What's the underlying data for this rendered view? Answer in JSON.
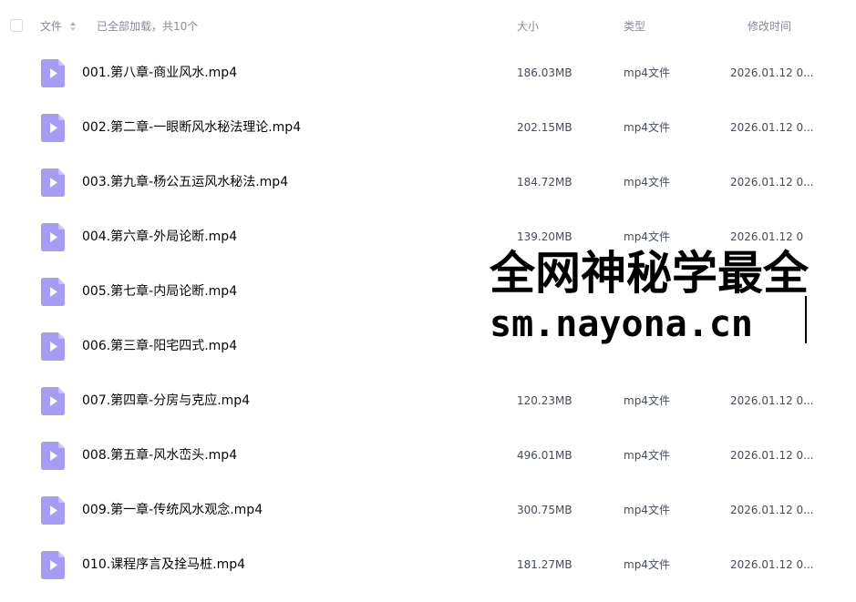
{
  "header": {
    "col_name": "文件",
    "load_status": "已全部加载，共10个",
    "col_size": "大小",
    "col_type": "类型",
    "col_time": "修改时间"
  },
  "files": [
    {
      "name": "001.第八章-商业风水.mp4",
      "size": "186.03MB",
      "type": "mp4文件",
      "time": "2026.01.12 0..."
    },
    {
      "name": "002.第二章-一眼断风水秘法理论.mp4",
      "size": "202.15MB",
      "type": "mp4文件",
      "time": "2026.01.12 0..."
    },
    {
      "name": "003.第九章-杨公五运风水秘法.mp4",
      "size": "184.72MB",
      "type": "mp4文件",
      "time": "2026.01.12 0..."
    },
    {
      "name": "004.第六章-外局论断.mp4",
      "size": "139.20MB",
      "type": "mp4文件",
      "time": "2026.01.12 0"
    },
    {
      "name": "005.第七章-内局论断.mp4",
      "size": "",
      "type": "",
      "time": ""
    },
    {
      "name": "006.第三章-阳宅四式.mp4",
      "size": "",
      "type": "",
      "time": ""
    },
    {
      "name": "007.第四章-分房与克应.mp4",
      "size": "120.23MB",
      "type": "mp4文件",
      "time": "2026.01.12 0..."
    },
    {
      "name": "008.第五章-风水峦头.mp4",
      "size": "496.01MB",
      "type": "mp4文件",
      "time": "2026.01.12 0..."
    },
    {
      "name": "009.第一章-传统风水观念.mp4",
      "size": "300.75MB",
      "type": "mp4文件",
      "time": "2026.01.12 0..."
    },
    {
      "name": "010.课程序言及拴马桩.mp4",
      "size": "181.27MB",
      "type": "mp4文件",
      "time": "2026.01.12 0..."
    }
  ],
  "watermark": {
    "line1": "全网神秘学最全",
    "line2": "sm.nayona.cn"
  },
  "colors": {
    "icon_bg": "#a69cf5",
    "icon_fold": "#cbc4fa",
    "text_header": "#878c9c",
    "text_name": "#06070a",
    "text_cell": "#454d5a"
  },
  "icons": {
    "file_icon": "video-file-icon",
    "sort_icon": "sort-icon"
  }
}
